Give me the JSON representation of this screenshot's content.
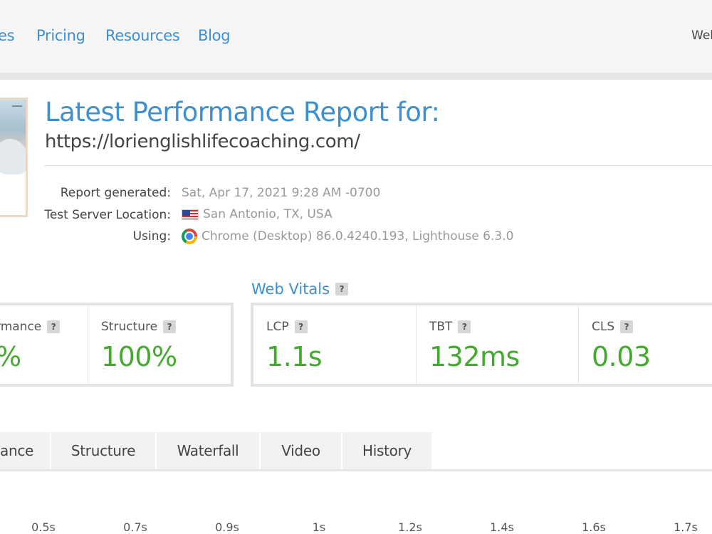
{
  "nav": {
    "items": [
      "es",
      "Pricing",
      "Resources",
      "Blog"
    ],
    "welcome": "Wel"
  },
  "report": {
    "title": "Latest Performance Report for:",
    "url": "https://lorienglishlifecoaching.com/",
    "meta": [
      {
        "label": "Report generated:",
        "value": "Sat, Apr 17, 2021 9:28 AM -0700",
        "icon": ""
      },
      {
        "label": "Test Server Location:",
        "value": "San Antonio, TX, USA",
        "icon": "us-flag-icon"
      },
      {
        "label": "Using:",
        "value": "Chrome (Desktop) 86.0.4240.193, Lighthouse 6.3.0",
        "icon": "chrome-icon"
      }
    ]
  },
  "scores": {
    "performance_label": "rmance",
    "performance_value": "%",
    "structure_label": "Structure",
    "structure_value": "100%",
    "help": "?"
  },
  "web_vitals": {
    "title": "Web Vitals",
    "help": "?",
    "lcp_label": "LCP",
    "lcp_value": "1.1s",
    "tbt_label": "TBT",
    "tbt_value": "132ms",
    "cls_label": "CLS",
    "cls_value": "0.03"
  },
  "tabs": [
    "ance",
    "Structure",
    "Waterfall",
    "Video",
    "History"
  ],
  "timeline": {
    "ticks": [
      "0.5s",
      "0.7s",
      "0.9s",
      "1s",
      "1.2s",
      "1.4s",
      "1.6s",
      "1.7s"
    ]
  },
  "colors": {
    "accent": "#3c8fd0",
    "good": "#43a92f"
  }
}
